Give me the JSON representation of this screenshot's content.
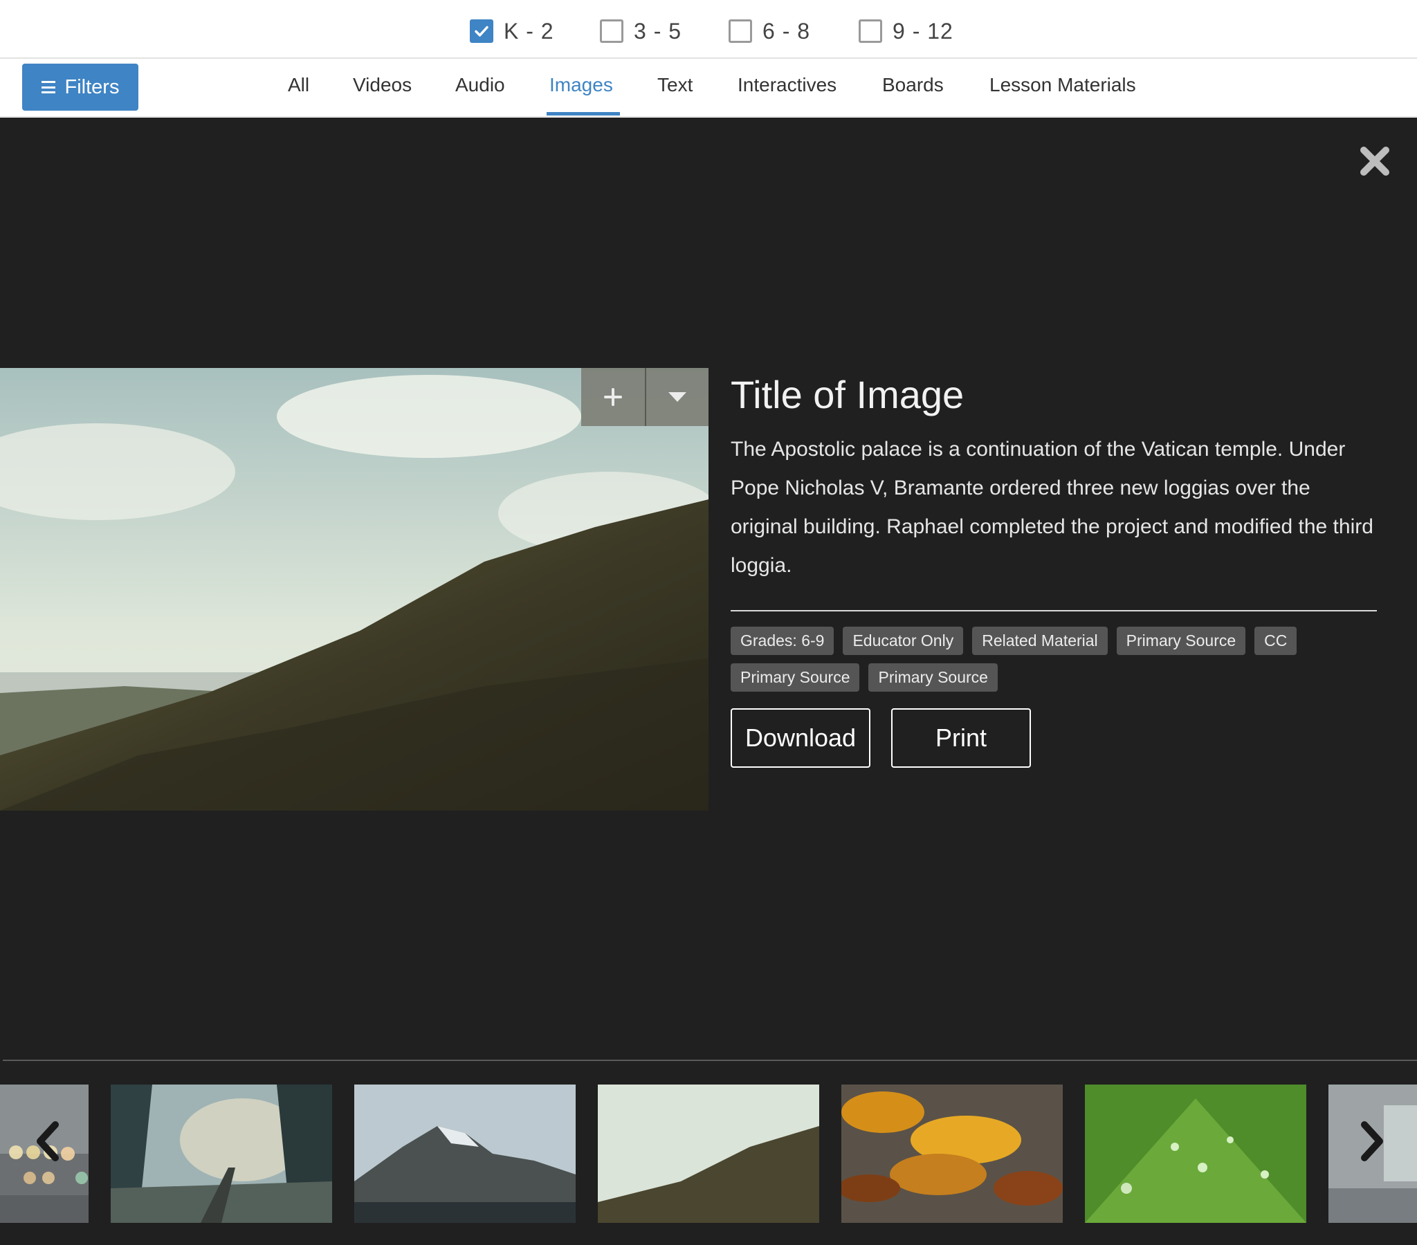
{
  "grades": [
    {
      "label": "K - 2",
      "checked": true
    },
    {
      "label": "3 - 5",
      "checked": false
    },
    {
      "label": "6 - 8",
      "checked": false
    },
    {
      "label": "9 - 12",
      "checked": false
    }
  ],
  "toolbar": {
    "filters_label": "Filters",
    "tabs": [
      "All",
      "Videos",
      "Audio",
      "Images",
      "Text",
      "Interactives",
      "Boards",
      "Lesson Materials"
    ],
    "active_tab": "Images"
  },
  "viewer": {
    "title": "Title of Image",
    "description": "The Apostolic palace is a continuation of the Vatican temple. Under Pope Nicholas V, Bramante ordered three new loggias over the original building. Raphael completed the project and modified the third loggia.",
    "tags": [
      "Grades: 6-9",
      "Educator Only",
      "Related Material",
      "Primary Source",
      "CC",
      "Primary Source",
      "Primary Source"
    ],
    "download_label": "Download",
    "print_label": "Print"
  },
  "icons": {
    "close": "close-icon",
    "add": "plus-icon",
    "more": "caret-down-icon",
    "prev": "chevron-left-icon",
    "next": "chevron-right-icon"
  },
  "colors": {
    "accent": "#3f84c4",
    "viewer_bg": "#202020",
    "tag_bg": "#555555"
  }
}
